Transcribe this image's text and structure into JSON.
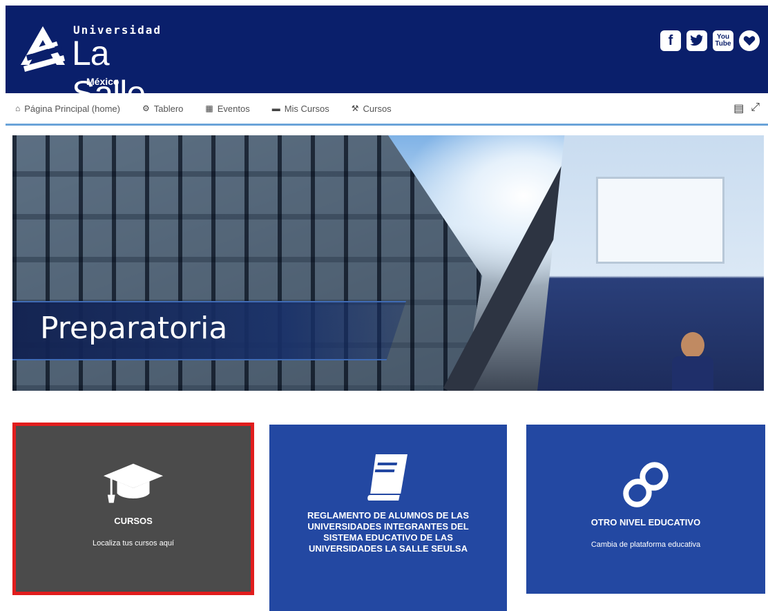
{
  "header": {
    "logo": {
      "univ": "Universidad",
      "name": "La Salle.",
      "country": "México"
    },
    "social": [
      "facebook-icon",
      "twitter-icon",
      "youtube-icon",
      "heart-icon"
    ],
    "youtube_top": "You",
    "youtube_bottom": "Tube"
  },
  "nav": {
    "items": [
      {
        "icon": "home-icon",
        "label": "Página Principal (home)"
      },
      {
        "icon": "dashboard-icon",
        "label": "Tablero"
      },
      {
        "icon": "calendar-icon",
        "label": "Eventos"
      },
      {
        "icon": "courses-icon",
        "label": "Mis Cursos"
      },
      {
        "icon": "wrench-icon",
        "label": "Cursos"
      }
    ]
  },
  "banner": {
    "title": "Preparatoria"
  },
  "cards": [
    {
      "icon": "graduation-cap-icon",
      "title": "CURSOS",
      "subtitle": "Localiza tus cursos aquí"
    },
    {
      "icon": "book-icon",
      "title": "REGLAMENTO DE ALUMNOS DE LAS UNIVERSIDADES INTEGRANTES DEL SISTEMA EDUCATIVO DE LAS UNIVERSIDADES LA SALLE SEULSA",
      "subtitle": ""
    },
    {
      "icon": "link-icon",
      "title": "OTRO NIVEL EDUCATIVO",
      "subtitle": "Cambia de plataforma educativa"
    }
  ],
  "colors": {
    "header_bg": "#0a1f6b",
    "card_blue": "#2348a2",
    "card_gray": "#4b4b4b",
    "highlight": "#e11d1d",
    "nav_border": "#6aa3d8"
  }
}
